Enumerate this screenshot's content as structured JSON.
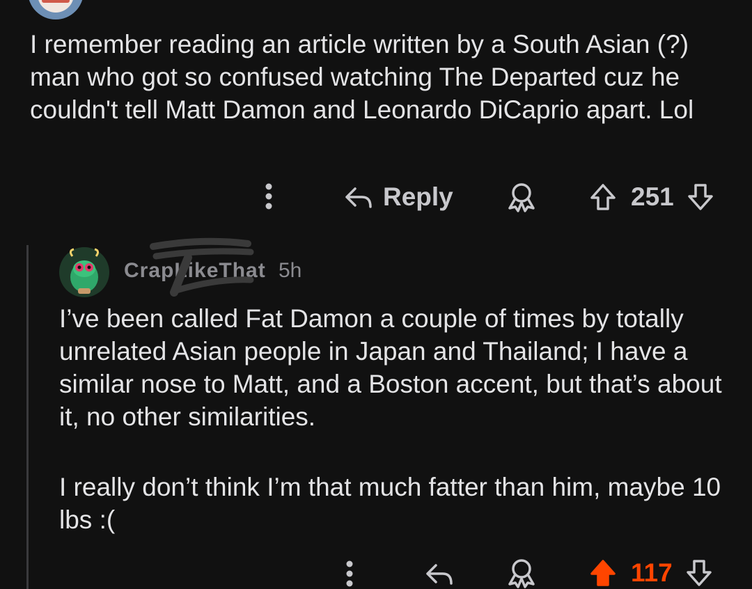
{
  "parent_comment": {
    "text": "I remember reading an article written by a South Asian (?) man who got so confused watching The Departed cuz he couldn't tell Matt Damon and Leonardo DiCaprio apart. Lol",
    "actions": {
      "more_icon": "vertical-ellipsis-icon",
      "reply_icon": "reply-arrow-icon",
      "reply_label": "Reply",
      "award_icon": "award-icon",
      "upvote_icon": "upvote-arrow-icon",
      "vote_count": "251",
      "downvote_icon": "downvote-arrow-icon"
    }
  },
  "reply_comment": {
    "username": "CrapLikeThat",
    "timestamp": "5h",
    "paragraph_1": "I’ve been called Fat Damon a couple of times by totally unrelated Asian people in Japan and Thailand; I have a similar nose to Matt, and a Boston accent, but that’s about it, no other similarities.",
    "paragraph_2": "I really don’t think I’m that much fatter than him, maybe 10 lbs :(",
    "actions": {
      "more_icon": "vertical-ellipsis-icon",
      "reply_icon": "reply-arrow-icon",
      "award_icon": "award-icon",
      "upvote_icon": "upvote-arrow-filled-icon",
      "vote_count": "117",
      "upvoted": true,
      "downvote_icon": "downvote-arrow-icon"
    }
  },
  "colors": {
    "background": "#111111",
    "text": "#e4e4e6",
    "muted": "#8b8b90",
    "icon": "#c8c8cc",
    "upvote_active": "#ff4500",
    "thread_line": "#3a3a3c"
  }
}
